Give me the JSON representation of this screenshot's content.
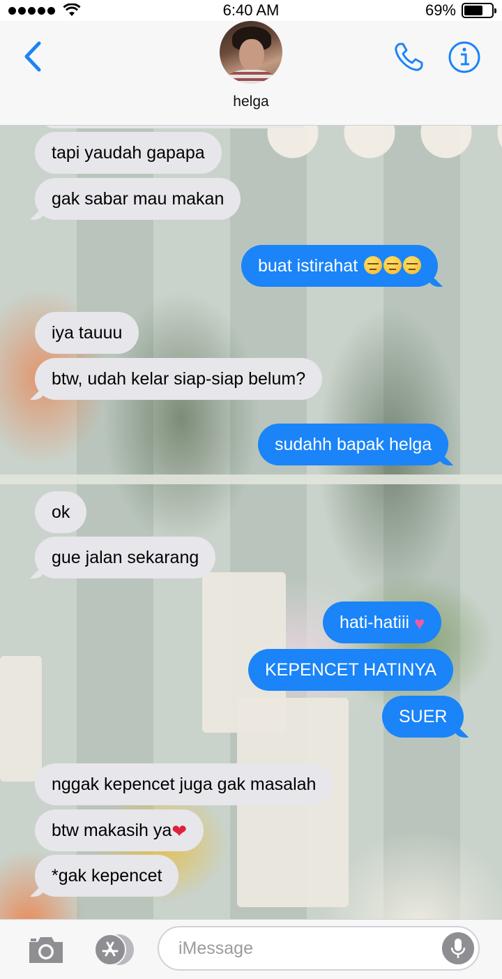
{
  "status_bar": {
    "time": "6:40 AM",
    "battery_percent": "69%",
    "battery_level": 0.69,
    "signal_bars": 5
  },
  "header": {
    "contact_name": "helga",
    "accent_color": "#1a84f8"
  },
  "messages": [
    {
      "direction": "incoming",
      "text": "tapi yaudah gapapa",
      "emoji": []
    },
    {
      "direction": "incoming",
      "text": "gak sabar mau makan",
      "emoji": []
    },
    {
      "direction": "outgoing",
      "text": "buat istirahat ",
      "emoji": [
        "unamused-face",
        "unamused-face",
        "unamused-face"
      ]
    },
    {
      "direction": "incoming",
      "text": "iya tauuu",
      "emoji": []
    },
    {
      "direction": "incoming",
      "text": "btw, udah kelar siap-siap belum?",
      "emoji": []
    },
    {
      "direction": "outgoing",
      "text": "sudahh bapak helga",
      "emoji": []
    },
    {
      "direction": "incoming",
      "text": "ok",
      "emoji": []
    },
    {
      "direction": "incoming",
      "text": "gue jalan sekarang",
      "emoji": []
    },
    {
      "direction": "outgoing",
      "text": "hati-hatiii ",
      "emoji": [
        "sparkling-heart"
      ]
    },
    {
      "direction": "outgoing",
      "text": "KEPENCET HATINYA",
      "emoji": []
    },
    {
      "direction": "outgoing",
      "text": "SUER",
      "emoji": []
    },
    {
      "direction": "incoming",
      "text": "nggak kepencet juga gak masalah",
      "emoji": []
    },
    {
      "direction": "incoming",
      "text": "btw makasih ya",
      "emoji": [
        "red-heart"
      ]
    },
    {
      "direction": "incoming",
      "text": "*gak kepencet",
      "emoji": []
    }
  ],
  "composer": {
    "placeholder": "iMessage",
    "value": ""
  }
}
